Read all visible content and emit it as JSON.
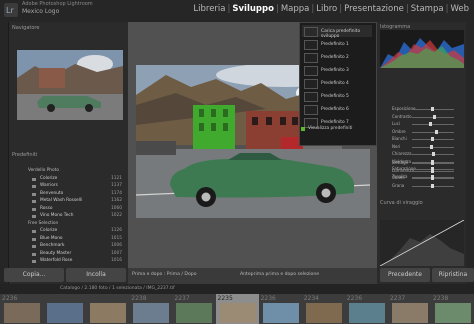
{
  "app": {
    "subtitle": "Adobe Photoshop Lightroom",
    "catalog": "Mexico Logo"
  },
  "modules": [
    "Libreria",
    "Sviluppo",
    "Mappa",
    "Libro",
    "Presentazione",
    "Stampa",
    "Web"
  ],
  "active_module": "Sviluppo",
  "left_panel": {
    "navigator_label": "Navigatore",
    "presets_label": "Predefiniti",
    "preset_rows": [
      {
        "label": "Verdello Photo",
        "count": ""
      },
      {
        "label": "Colorize",
        "count": "1121"
      },
      {
        "label": "Warriors",
        "count": "1137"
      },
      {
        "label": "Benvenuto",
        "count": "1174"
      },
      {
        "label": "Metal Wash Rosselli",
        "count": "1162"
      },
      {
        "label": "Rosso",
        "count": "1060"
      },
      {
        "label": "Vino Mono Tech",
        "count": "1022"
      },
      {
        "label": "Free Selection",
        "count": ""
      },
      {
        "label": "Colorize",
        "count": "1126"
      },
      {
        "label": "Blue Mono",
        "count": "1015"
      },
      {
        "label": "Benchmark",
        "count": "1006"
      },
      {
        "label": "Beauty Master",
        "count": "1007"
      },
      {
        "label": "Waterfold Rose",
        "count": "1016"
      }
    ],
    "copy_label": "Copia...",
    "paste_label": "Incolla"
  },
  "dropdown": {
    "items": [
      "Carica predefinito sviluppo",
      "Predefinito 1",
      "Predefinito 2",
      "Predefinito 3",
      "Predefinito 4",
      "Predefinito 5",
      "Predefinito 6",
      "Predefinito 7"
    ],
    "footer": "Visualizza predefiniti"
  },
  "center_toolbar": {
    "left_text": "Prima e dopo : Prima / Dopo",
    "right_text": "Anteprima prima e dopo selezione"
  },
  "right_panel": {
    "histogram_label": "Istogramma",
    "sliders": [
      {
        "label": "Esposizione",
        "value": 0.5
      },
      {
        "label": "Contrasto",
        "value": 0.55
      },
      {
        "label": "Luci",
        "value": 0.45
      },
      {
        "label": "Ombre",
        "value": 0.6
      },
      {
        "label": "Bianchi",
        "value": 0.5
      },
      {
        "label": "Neri",
        "value": 0.48
      },
      {
        "label": "Chiarezza",
        "value": 0.52
      },
      {
        "label": "Vividezza",
        "value": 0.5
      },
      {
        "label": "Saturazione",
        "value": 0.5
      },
      {
        "label": "Tonalità",
        "value": 0.5
      },
      {
        "label": "Dettagli",
        "value": 0.5
      },
      {
        "label": "Luminanza",
        "value": 0.5
      },
      {
        "label": "Colore",
        "value": 0.5
      },
      {
        "label": "Grana",
        "value": 0.5
      }
    ],
    "curve_label": "Curva di viraggio",
    "previous_label": "Precedente",
    "reset_label": "Ripristina"
  },
  "filmstrip": {
    "info": "Catalogo / 2.180 foto / 1 selezionata / IMG_2237.tif",
    "frames": [
      "2236",
      "",
      "",
      "2238",
      "2237",
      "2235",
      "2236",
      "2234",
      "2236",
      "2237",
      "2238"
    ],
    "selected_index": 5
  },
  "colors": {
    "accent_green": "#5fb82a",
    "selected_frame": "#8d8d8d"
  }
}
